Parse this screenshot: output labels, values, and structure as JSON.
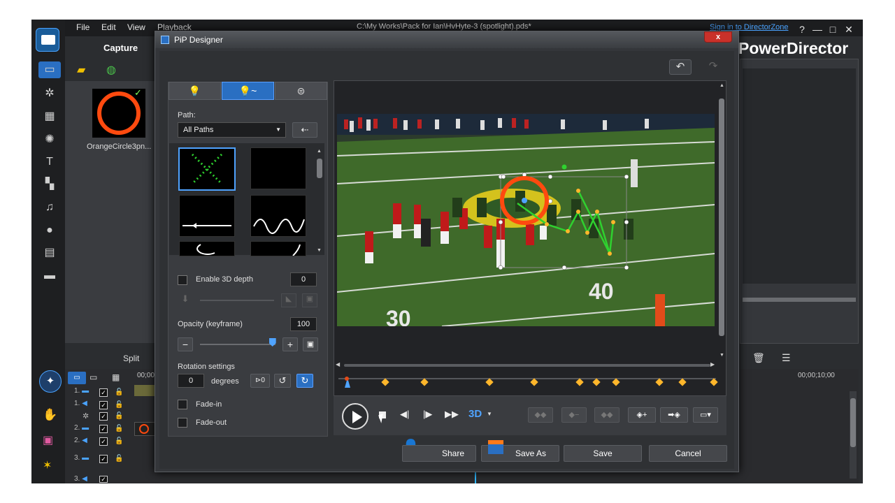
{
  "app": {
    "menu": [
      "File",
      "Edit",
      "View",
      "Playback"
    ],
    "file_path": "C:\\My Works\\Pack for Ian\\HvHyte-3 (spotlight).pds*",
    "sign_in": "Sign in to DirectorZone",
    "brand": "PowerDirector",
    "capture_label": "Capture",
    "media_item_label": "OrangeCircle3pn...",
    "split_label": "Split",
    "timeline_time_left": "00;00",
    "timeline_time_right": "00;00;10;00",
    "help_icon": "?",
    "minimize_icon": "—",
    "maximize_icon": "□",
    "close_icon": "✕",
    "track_numbers": [
      "1.",
      "1.",
      "",
      "2.",
      "2.",
      "3.",
      "3."
    ]
  },
  "dialog": {
    "title": "PiP Designer",
    "close_label": "x",
    "path_label": "Path:",
    "path_dropdown_value": "All Paths",
    "enable_3d_label": "Enable 3D depth",
    "depth_value": "0",
    "opacity_label": "Opacity (keyframe)",
    "opacity_value": "100",
    "opacity_fraction": 0.96,
    "rotation_label": "Rotation settings",
    "rotation_value": "0",
    "degrees_label": "degrees",
    "fade_in_label": "Fade-in",
    "fade_out_label": "Fade-out",
    "mode_3d_label": "3D",
    "share_label": "Share",
    "save_as_label": "Save As",
    "save_label": "Save",
    "cancel_label": "Cancel",
    "yard_numbers": [
      "30",
      "40"
    ]
  },
  "colors": {
    "accent": "#2a6fc2",
    "ring": "#ff4a0f",
    "path_green": "#2fd12f",
    "keyframe": "#ffb62b",
    "field": "#3f6a2a"
  },
  "icons": {
    "undo": "undo-icon",
    "redo": "redo-icon",
    "play": "play-icon",
    "stop": "stop-icon"
  }
}
